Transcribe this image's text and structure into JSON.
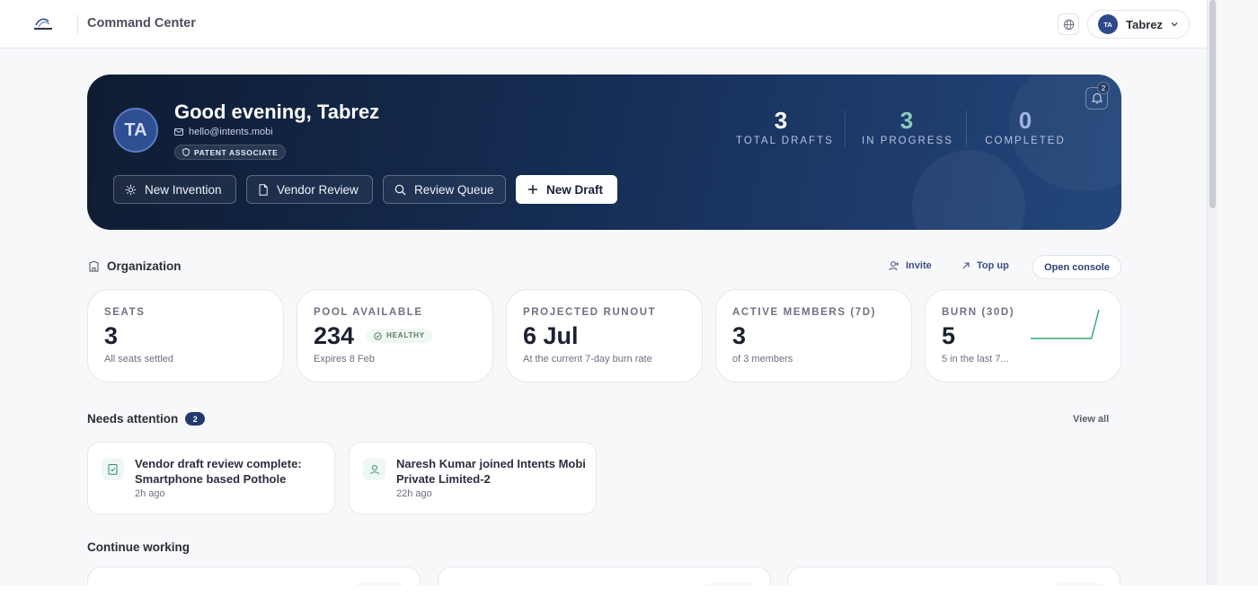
{
  "topbar": {
    "title": "Command Center",
    "logo_icon": "brand-logo",
    "user_initials": "TA",
    "user_name": "Tabrez"
  },
  "hero": {
    "avatar_initials": "TA",
    "greeting": "Good evening, Tabrez",
    "email": "hello@intents.mobi",
    "role": "PATENT ASSOCIATE",
    "notifications_count": "2",
    "stats": [
      {
        "value": "3",
        "label": "TOTAL DRAFTS",
        "color": "#ffffff"
      },
      {
        "value": "3",
        "label": "IN PROGRESS",
        "color": "#8fc7c0"
      },
      {
        "value": "0",
        "label": "COMPLETED",
        "color": "#9fb4e6"
      }
    ],
    "actions": [
      {
        "label": "New Invention",
        "icon": "sparkle-icon"
      },
      {
        "label": "Vendor Review",
        "icon": "document-icon"
      },
      {
        "label": "Review Queue",
        "icon": "search-icon"
      },
      {
        "label": "New Draft",
        "icon": "plus-icon"
      }
    ]
  },
  "organization": {
    "title": "Organization",
    "invite_label": "Invite",
    "topup_label": "Top up",
    "console_label": "Open console",
    "metrics": [
      {
        "label": "SEATS",
        "value": "3",
        "sub": "All seats settled"
      },
      {
        "label": "POOL AVAILABLE",
        "value": "234",
        "badge": "HEALTHY",
        "sub": "Expires 8 Feb"
      },
      {
        "label": "PROJECTED RUNOUT",
        "value": "6 Jul",
        "sub": "At the current 7-day burn rate"
      },
      {
        "label": "ACTIVE MEMBERS (7D)",
        "value": "3",
        "sub": "of 3 members"
      },
      {
        "label": "BURN (30D)",
        "value": "5",
        "sub": "5 in the last 7..."
      }
    ],
    "burn_sparkline": [
      0,
      0,
      0,
      0,
      0,
      0,
      0,
      0,
      0,
      5
    ]
  },
  "attention": {
    "title": "Needs attention",
    "count": "2",
    "view_all": "View all",
    "items": [
      {
        "text": "Vendor draft review complete: Smartphone based Pothole Detection",
        "time": "2h ago",
        "icon": "clipboard-check-icon"
      },
      {
        "text": "Naresh Kumar joined Intents Mobi Private Limited-2",
        "time": "22h ago",
        "icon": "user-icon"
      }
    ]
  },
  "continue": {
    "title": "Continue working"
  },
  "colors": {
    "accent": "#223b6d",
    "success": "#2fa56a",
    "hero_bg": "#142a4e"
  }
}
